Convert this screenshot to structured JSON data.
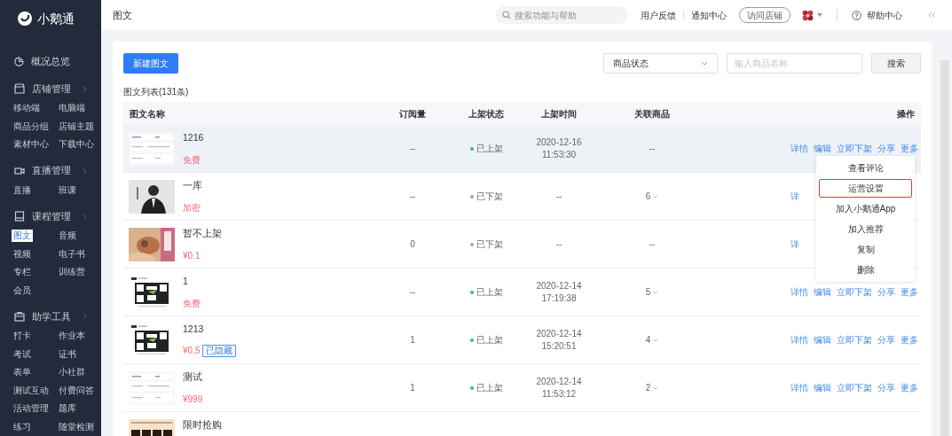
{
  "sidebar": {
    "logo": "小鹅通",
    "top_item": {
      "label": "概况总览"
    },
    "groups": [
      {
        "label": "店铺管理",
        "items": [
          {
            "label": "移动端",
            "selected": false
          },
          {
            "label": "电脑端",
            "selected": false
          },
          {
            "label": "商品分组",
            "selected": false
          },
          {
            "label": "店铺主题",
            "selected": false
          },
          {
            "label": "素材中心",
            "selected": false
          },
          {
            "label": "下载中心",
            "selected": false
          }
        ]
      },
      {
        "label": "直播管理",
        "items": [
          {
            "label": "直播",
            "selected": false
          },
          {
            "label": "班课",
            "selected": false
          }
        ]
      },
      {
        "label": "课程管理",
        "items": [
          {
            "label": "图文",
            "selected": true
          },
          {
            "label": "音频",
            "selected": false
          },
          {
            "label": "视频",
            "selected": false
          },
          {
            "label": "电子书",
            "selected": false
          },
          {
            "label": "专栏",
            "selected": false
          },
          {
            "label": "训练营",
            "selected": false
          },
          {
            "label": "会员",
            "selected": false
          }
        ]
      },
      {
        "label": "助学工具",
        "items": [
          {
            "label": "打卡",
            "selected": false
          },
          {
            "label": "作业本",
            "selected": false
          },
          {
            "label": "考试",
            "selected": false
          },
          {
            "label": "证书",
            "selected": false
          },
          {
            "label": "表单",
            "selected": false
          },
          {
            "label": "小社群",
            "selected": false
          },
          {
            "label": "测试互动",
            "selected": false
          },
          {
            "label": "付费问答",
            "selected": false
          },
          {
            "label": "活动管理",
            "selected": false
          },
          {
            "label": "题库",
            "selected": false
          },
          {
            "label": "练习",
            "selected": false
          },
          {
            "label": "随堂检测",
            "selected": false
          }
        ]
      }
    ]
  },
  "header": {
    "title": "图文",
    "search": {
      "placeholder": "搜索功能与帮助"
    },
    "links": [
      "用户反馈",
      "通知中心"
    ],
    "visit_button": "访问店铺",
    "help": "帮助中心"
  },
  "toolbar": {
    "new_button": "新建图文",
    "status_select": {
      "value": "商品状态"
    },
    "name_input": {
      "placeholder": "输入商品名称"
    },
    "search_button": "搜索"
  },
  "list_title": "图文列表(131条)",
  "table": {
    "columns": [
      "图文名称",
      "订阅量",
      "上架状态",
      "上架时间",
      "关联商品",
      "操作"
    ],
    "rows": [
      {
        "name": "1216",
        "price": "免费",
        "subs": "--",
        "status": "已上架",
        "listed": true,
        "time": [
          "2020-12-16",
          "11:53:30"
        ],
        "related": "--",
        "related_expandable": false,
        "highlighted": true,
        "actions": [
          "详情",
          "编辑",
          "立即下架",
          "分享",
          "更多"
        ]
      },
      {
        "name": "一库",
        "price": "加密",
        "subs": "--",
        "status": "已下架",
        "listed": false,
        "time": [
          "--"
        ],
        "related": "6",
        "related_expandable": true,
        "highlighted": false,
        "actions": [
          "详"
        ]
      },
      {
        "name": "暂不上架",
        "price": "¥0.1",
        "subs": "0",
        "status": "已下架",
        "listed": false,
        "time": [
          "--"
        ],
        "related": "--",
        "related_expandable": false,
        "highlighted": false,
        "actions": [
          "详"
        ]
      },
      {
        "name": "1",
        "price": "免费",
        "subs": "--",
        "status": "已上架",
        "listed": true,
        "time": [
          "2020-12-14",
          "17:19:38"
        ],
        "related": "5",
        "related_expandable": true,
        "highlighted": false,
        "actions": [
          "详情",
          "编辑",
          "立即下架",
          "分享",
          "更多"
        ]
      },
      {
        "name": "1213",
        "price": "¥0.5",
        "tag": "已隐藏",
        "subs": "1",
        "status": "已上架",
        "listed": true,
        "time": [
          "2020-12-14",
          "15:20:51"
        ],
        "related": "4",
        "related_expandable": true,
        "highlighted": false,
        "actions": [
          "详情",
          "编辑",
          "立即下架",
          "分享",
          "更多"
        ]
      },
      {
        "name": "测试",
        "price": "¥999",
        "subs": "1",
        "status": "已上架",
        "listed": true,
        "time": [
          "2020-12-14",
          "11:53:12"
        ],
        "related": "2",
        "related_expandable": true,
        "highlighted": false,
        "actions": [
          "详情",
          "编辑",
          "立即下架",
          "分享",
          "更多"
        ]
      },
      {
        "name": "限时抢购",
        "highlighted": false
      }
    ]
  },
  "more_menu": {
    "items": [
      {
        "label": "查看评论",
        "selected": false
      },
      {
        "label": "运营设置",
        "selected": true
      },
      {
        "label": "加入小鹅通App",
        "selected": false
      },
      {
        "label": "加入推荐",
        "selected": false
      },
      {
        "label": "复制",
        "selected": false
      },
      {
        "label": "删除",
        "selected": false
      }
    ]
  }
}
